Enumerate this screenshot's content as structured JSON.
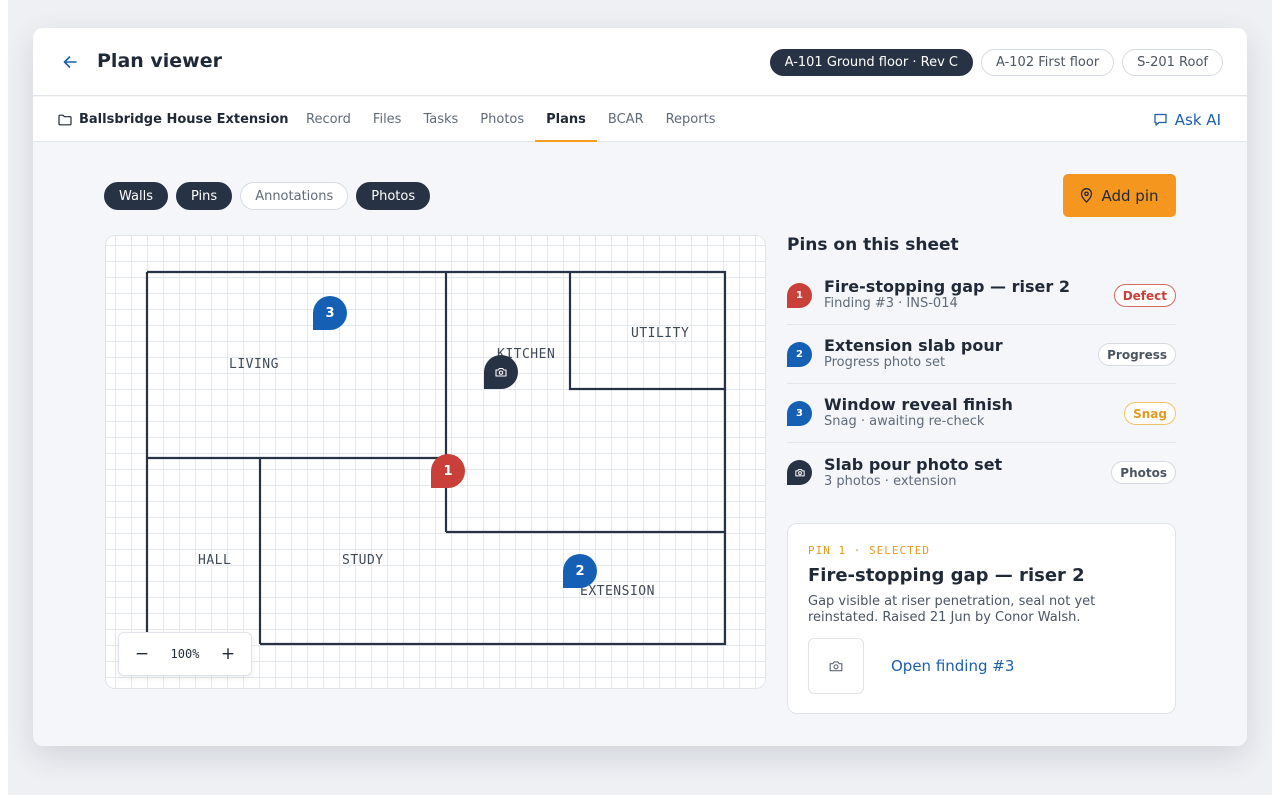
{
  "header": {
    "title": "Plan viewer",
    "sheets": [
      {
        "label": "A-101 Ground floor · Rev C",
        "active": true
      },
      {
        "label": "A-102 First floor",
        "active": false
      },
      {
        "label": "S-201 Roof",
        "active": false
      }
    ]
  },
  "nav": {
    "project": "Ballsbridge House Extension",
    "links": [
      "Record",
      "Files",
      "Tasks",
      "Photos",
      "Plans",
      "BCAR",
      "Reports"
    ],
    "active": "Plans",
    "ask_ai": "Ask AI"
  },
  "layers": [
    {
      "label": "Walls",
      "on": true
    },
    {
      "label": "Pins",
      "on": true
    },
    {
      "label": "Annotations",
      "on": false
    },
    {
      "label": "Photos",
      "on": true
    }
  ],
  "add_pin_label": "Add pin",
  "plan": {
    "rooms": [
      "LIVING",
      "KITCHEN",
      "UTILITY",
      "HALL",
      "STUDY",
      "EXTENSION"
    ],
    "pins": [
      "1",
      "2",
      "3"
    ],
    "zoom": {
      "minus": "−",
      "level": "100%",
      "plus": "+"
    }
  },
  "side": {
    "title": "Pins on this sheet",
    "pins": [
      {
        "marker": "1",
        "title": "Fire-stopping gap — riser 2",
        "sub": "Finding #3 · INS-014",
        "badge": "Defect"
      },
      {
        "marker": "2",
        "title": "Extension slab pour",
        "sub": "Progress photo set",
        "badge": "Progress"
      },
      {
        "marker": "3",
        "title": "Window reveal finish",
        "sub": "Snag · awaiting re-check",
        "badge": "Snag"
      },
      {
        "marker": "camera-icon",
        "title": "Slab pour photo set",
        "sub": "3 photos · extension",
        "badge": "Photos"
      }
    ],
    "detail": {
      "eyebrow": "PIN 1 · SELECTED",
      "title": "Fire-stopping gap — riser 2",
      "body": "Gap visible at riser penetration, seal not yet reinstated. Raised 21 Jun by Conor Walsh.",
      "link": "Open finding #3"
    }
  },
  "colors": {
    "accent": "#f5961f",
    "dark": "#273244",
    "defect": "#c9403a",
    "pin_blue": "#1560b5",
    "link": "#1d5fad",
    "snag": "#e39a1f"
  }
}
